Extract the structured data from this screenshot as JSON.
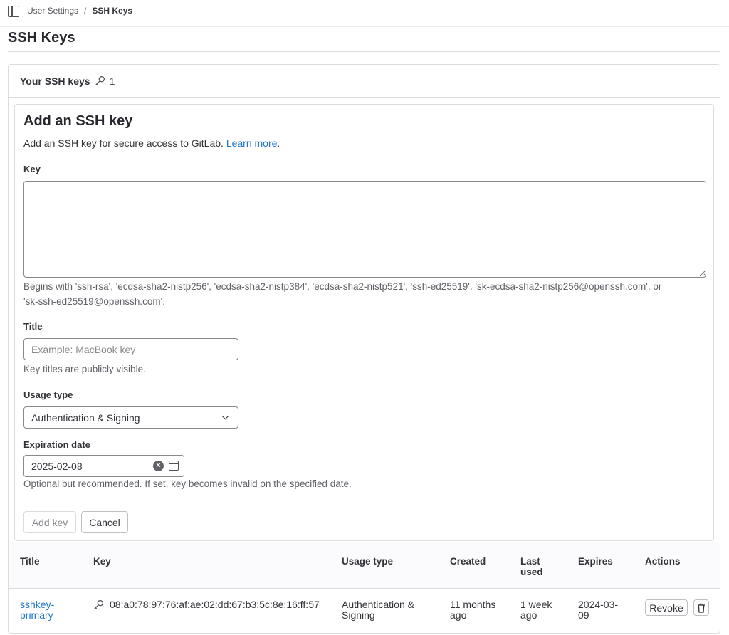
{
  "breadcrumb": {
    "parent": "User Settings",
    "separator": "/",
    "current": "SSH Keys"
  },
  "page": {
    "title": "SSH Keys"
  },
  "card": {
    "label": "Your SSH keys",
    "count": "1",
    "icon": "key-icon"
  },
  "form": {
    "title": "Add an SSH key",
    "description": "Add an SSH key for secure access to GitLab.",
    "learn_more": "Learn more",
    "description_end": ".",
    "key_label": "Key",
    "key_value": "",
    "key_help_1": "Begins with 'ssh-rsa', 'ecdsa-sha2-nistp256', 'ecdsa-sha2-nistp384', 'ecdsa-sha2-nistp521', 'ssh-ed25519', 'sk-ecdsa-sha2-nistp256@openssh.com', or",
    "key_help_2": "'sk-ssh-ed25519@openssh.com'.",
    "title_label": "Title",
    "title_placeholder": "Example: MacBook key",
    "title_help": "Key titles are publicly visible.",
    "usage_label": "Usage type",
    "usage_value": "Authentication & Signing",
    "expiration_label": "Expiration date",
    "expiration_value": "2025-02-08",
    "expiration_help": "Optional but recommended. If set, key becomes invalid on the specified date.",
    "add_button": "Add key",
    "cancel_button": "Cancel"
  },
  "table": {
    "headers": {
      "title": "Title",
      "key": "Key",
      "usage": "Usage type",
      "created": "Created",
      "last_used_1": "Last",
      "last_used_2": "used",
      "expires": "Expires",
      "actions": "Actions"
    },
    "rows": [
      {
        "title_1": "sshkey-",
        "title_2": "primary",
        "fingerprint": "08:a0:78:97:76:af:ae:02:dd:67:b3:5c:8e:16:ff:57",
        "usage_1": "Authentication &",
        "usage_2": "Signing",
        "created_1": "11 months",
        "created_2": "ago",
        "last_used_1": "1 week",
        "last_used_2": "ago",
        "expires_1": "2024-03-",
        "expires_2": "09",
        "revoke": "Revoke"
      }
    ]
  }
}
